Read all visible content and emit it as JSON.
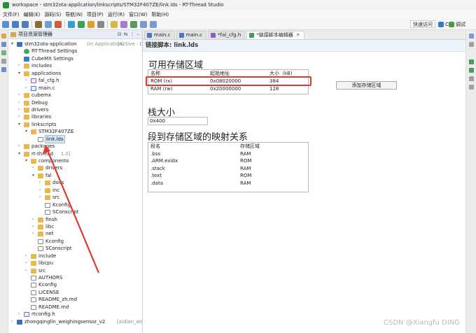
{
  "window": {
    "title": "workspace - stm32ota-application/linkscripts/STM32F407ZE/link.lds - RT-Thread Studio"
  },
  "menu": [
    "文件(F)",
    "编辑(E)",
    "源码(S)",
    "导航(N)",
    "项目(P)",
    "运行(R)",
    "窗口(W)",
    "帮助(H)"
  ],
  "toolbar": {
    "quick_access": "快速访问",
    "perspective_c": "C",
    "perspective_debug": "调试"
  },
  "explorer": {
    "title": "项目资源管理器",
    "tree": [
      {
        "label": "stm32ota-application",
        "suffix": "(in Application)",
        "extra": "[Active - De",
        "icon": "proj",
        "arrow": "down",
        "indent": 0
      },
      {
        "label": "RT-Thread Settings",
        "icon": "gear",
        "indent": 1
      },
      {
        "label": "CubeMX Settings",
        "icon": "cube",
        "indent": 1
      },
      {
        "label": "Includes",
        "icon": "folder",
        "arrow": "right",
        "indent": 1
      },
      {
        "label": "applications",
        "icon": "folder",
        "arrow": "down",
        "indent": 1,
        "prefix": ">"
      },
      {
        "label": "fal_cfg.h",
        "icon": "hfile",
        "arrow": "right",
        "indent": 2
      },
      {
        "label": "main.c",
        "icon": "cfile",
        "arrow": "right",
        "indent": 2
      },
      {
        "label": "cubemx",
        "icon": "folder",
        "arrow": "right",
        "indent": 1,
        "prefix": ">"
      },
      {
        "label": "Debug",
        "icon": "folder",
        "arrow": "right",
        "indent": 1
      },
      {
        "label": "drivers",
        "icon": "folder",
        "arrow": "right",
        "indent": 1,
        "prefix": ">"
      },
      {
        "label": "libraries",
        "icon": "folder",
        "arrow": "right",
        "indent": 1,
        "prefix": ">"
      },
      {
        "label": "linkscripts",
        "icon": "folder",
        "arrow": "down",
        "indent": 1,
        "prefix": ">"
      },
      {
        "label": "STM32F407ZE",
        "icon": "folder",
        "arrow": "down",
        "indent": 2,
        "prefix": ">"
      },
      {
        "label": "link.lds",
        "icon": "file",
        "indent": 3,
        "selected": true
      },
      {
        "label": "packages",
        "icon": "folder",
        "arrow": "right",
        "indent": 1,
        "prefix": ">"
      },
      {
        "label": "rt-thread",
        "suffix": "1.0]",
        "icon": "folder",
        "arrow": "down",
        "indent": 1,
        "prefix": ">"
      },
      {
        "label": "components",
        "icon": "folder",
        "arrow": "down",
        "indent": 2,
        "prefix": ">"
      },
      {
        "label": "drivers",
        "icon": "folder",
        "arrow": "right",
        "indent": 3,
        "prefix": ">"
      },
      {
        "label": "fal",
        "icon": "folder",
        "arrow": "down",
        "indent": 3,
        "prefix": ">"
      },
      {
        "label": "docs",
        "icon": "folder",
        "arrow": "right",
        "indent": 4,
        "prefix": ">"
      },
      {
        "label": "inc",
        "icon": "folder",
        "arrow": "right",
        "indent": 4,
        "prefix": ">"
      },
      {
        "label": "src",
        "icon": "folder",
        "arrow": "right",
        "indent": 4,
        "prefix": ">"
      },
      {
        "label": "Kconfig",
        "icon": "file",
        "indent": 4
      },
      {
        "label": "SConscript",
        "icon": "file",
        "indent": 4
      },
      {
        "label": "finsh",
        "icon": "folder",
        "arrow": "right",
        "indent": 3,
        "prefix": ">"
      },
      {
        "label": "libc",
        "icon": "folder",
        "arrow": "right",
        "indent": 3,
        "prefix": ">"
      },
      {
        "label": "net",
        "icon": "folder",
        "arrow": "right",
        "indent": 3,
        "prefix": ">"
      },
      {
        "label": "Kconfig",
        "icon": "file",
        "indent": 3
      },
      {
        "label": "SConscript",
        "icon": "file",
        "indent": 3
      },
      {
        "label": "include",
        "icon": "folder",
        "arrow": "right",
        "indent": 2,
        "prefix": ">"
      },
      {
        "label": "libcpu",
        "icon": "folder",
        "arrow": "right",
        "indent": 2,
        "prefix": ">"
      },
      {
        "label": "src",
        "icon": "folder",
        "arrow": "right",
        "indent": 2,
        "prefix": ">"
      },
      {
        "label": "AUTHORS",
        "icon": "file",
        "indent": 2
      },
      {
        "label": "Kconfig",
        "icon": "file",
        "indent": 2
      },
      {
        "label": "LICENSE",
        "icon": "file",
        "indent": 2
      },
      {
        "label": "README_zh.md",
        "icon": "file",
        "indent": 2
      },
      {
        "label": "README.md",
        "icon": "file",
        "indent": 2
      },
      {
        "label": "rtconfig.h",
        "icon": "hfile",
        "arrow": "right",
        "indent": 1
      },
      {
        "label": "zhongqinglin_weighingsensor_v2",
        "suffix": "[xidian_weighingse",
        "icon": "proj",
        "arrow": "right",
        "indent": 0
      }
    ]
  },
  "tabs": [
    {
      "label": "main.c",
      "active": false
    },
    {
      "label": "main.c",
      "active": false
    },
    {
      "label": "*fal_cfg.h",
      "active": false
    },
    {
      "label": "*链接脚本编辑器",
      "active": true
    }
  ],
  "editor": {
    "header": "链接脚本: link.lds",
    "memory_section": "可用存储区域",
    "memory_headers": [
      "名称",
      "起始地址",
      "大小（kB)"
    ],
    "memory_rows": [
      [
        "ROM (rx)",
        "0x08020000",
        "384"
      ],
      [
        "RAM (rw)",
        "0x20000000",
        "128"
      ]
    ],
    "add_button": "添加存储区域",
    "stack_section": "栈大小",
    "stack_value": "0x400",
    "mapping_section": "段到存储区域的映射关系",
    "mapping_headers": [
      "段名",
      "存储区域"
    ],
    "mapping_rows": [
      [
        ".bss",
        "RAM"
      ],
      [
        ".ARM.exidx",
        "ROM"
      ],
      [
        ".stack",
        "RAM"
      ],
      [
        ".text",
        "ROM"
      ],
      [
        ".data",
        "RAM"
      ]
    ]
  },
  "watermark": "CSDN @Xiangfu DING",
  "colors": {
    "annotation_red": "#e03a2e"
  }
}
